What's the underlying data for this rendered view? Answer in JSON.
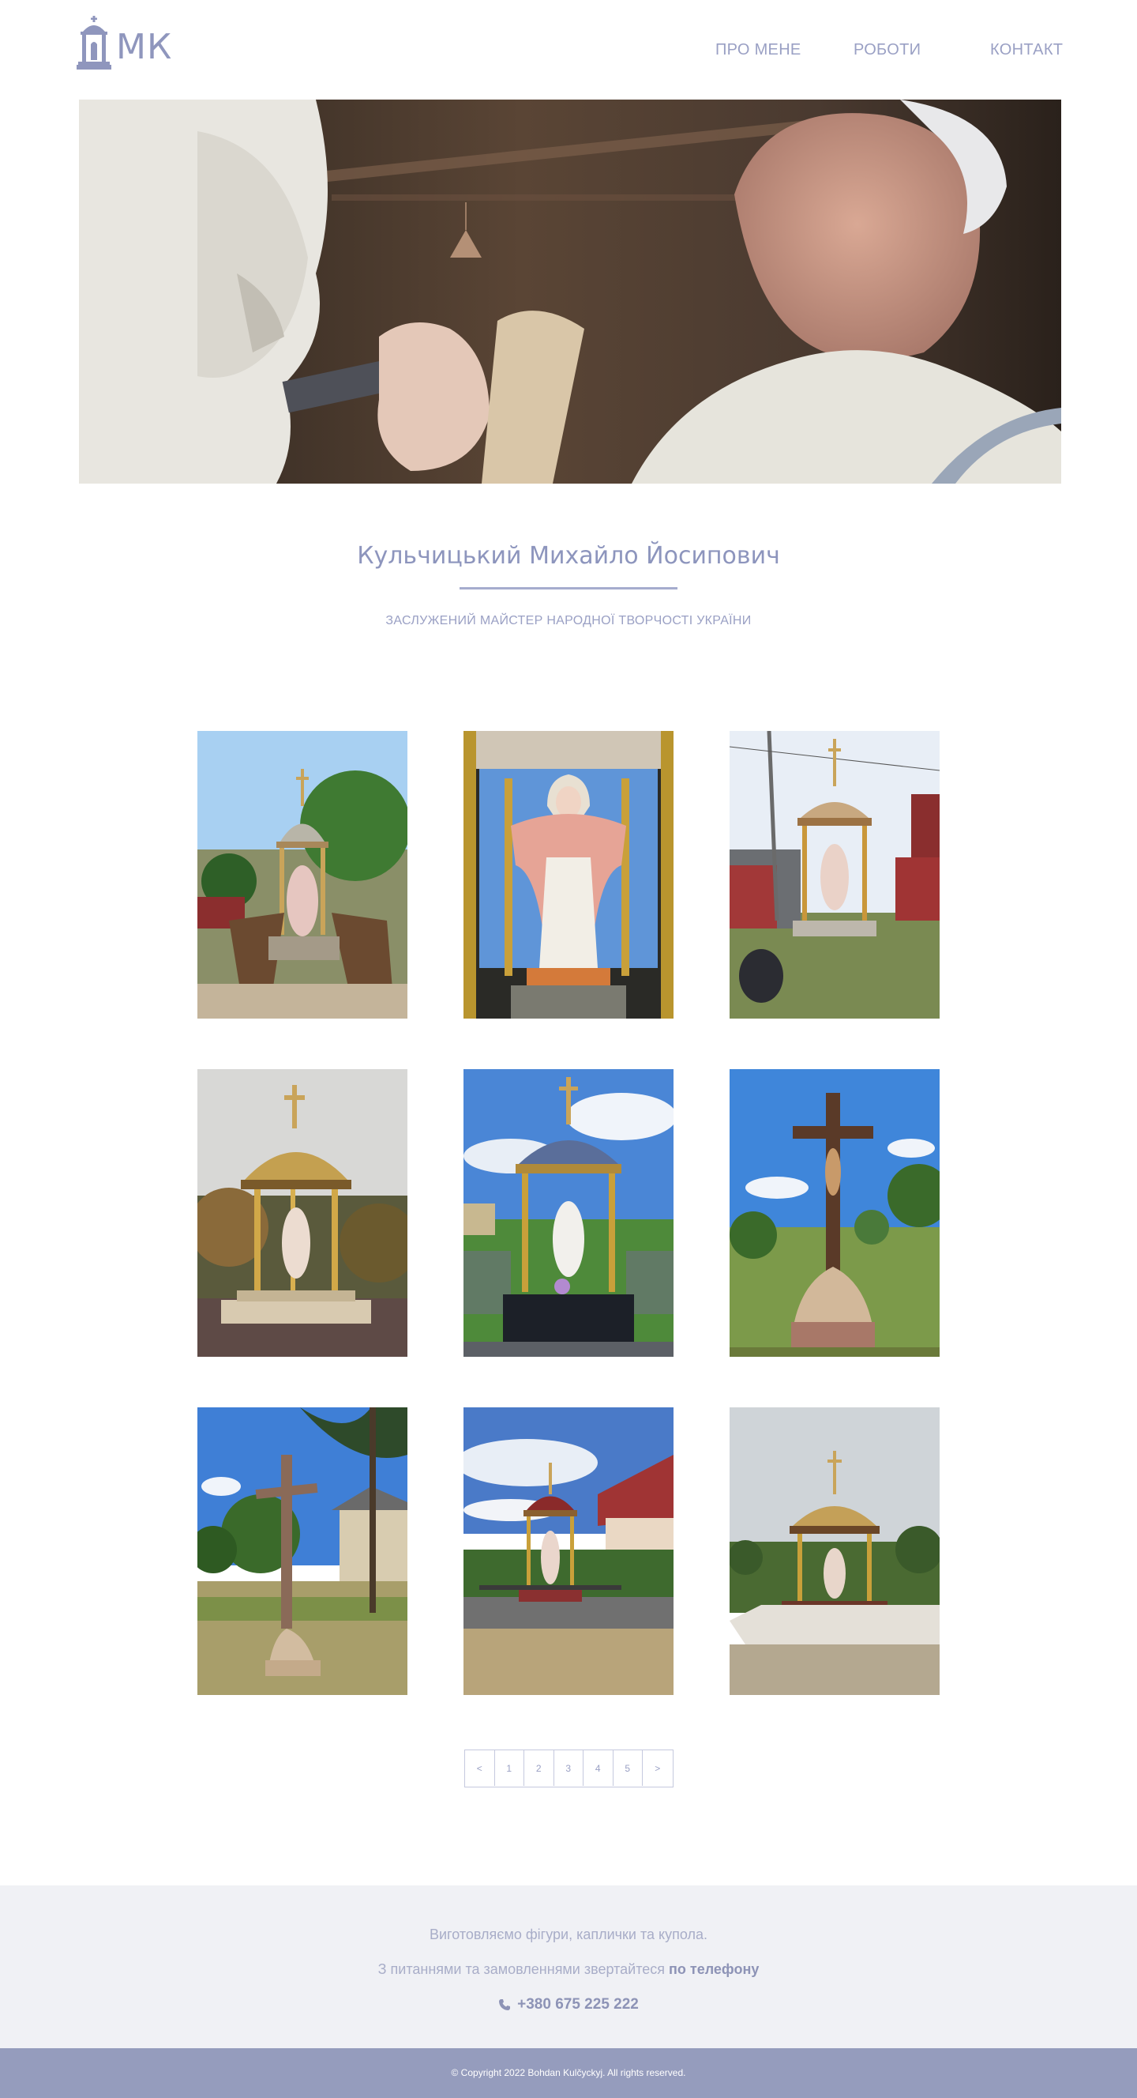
{
  "header": {
    "logo_text": "МК",
    "nav": [
      {
        "label": "ПРО МЕНЕ"
      },
      {
        "label": "РОБОТИ"
      },
      {
        "label": "КОНТАКТ"
      }
    ]
  },
  "hero": {
    "image": "hero-sculptor-carving-image"
  },
  "profile": {
    "name": "Кульчицький Михайло Йосипович",
    "subtitle": "ЗАСЛУЖЕНИЙ МАЙСТЕР НАРОДНОЇ ТВОРЧОСТІ УКРАЇНИ"
  },
  "gallery": {
    "items": [
      {
        "image": "chapel-under-construction-photo"
      },
      {
        "image": "madonna-statue-closeup-photo"
      },
      {
        "image": "chapel-in-yard-photo"
      },
      {
        "image": "golden-dome-chapel-photo"
      },
      {
        "image": "blue-dome-chapel-photo"
      },
      {
        "image": "crucifix-monument-photo"
      },
      {
        "image": "crucifix-near-house-photo"
      },
      {
        "image": "red-dome-chapel-photo"
      },
      {
        "image": "chapel-on-stone-base-photo"
      }
    ]
  },
  "pagination": {
    "prev": "<",
    "pages": [
      "1",
      "2",
      "3",
      "4",
      "5"
    ],
    "next": ">"
  },
  "footer": {
    "line1": "Виготовляємо фігури, каплички та купола.",
    "line2_text": "З питаннями та замовленнями звертайтеся",
    "line2_bold": "по телефону",
    "phone": "+380 675 225 222",
    "copyright": "© Copyright 2022 Bohdan Kulčyckyj. All rights reserved."
  },
  "colors": {
    "accent": "#8f96bd",
    "footer_bg": "#f0f1f5",
    "copyright_bg": "#959cbd"
  }
}
